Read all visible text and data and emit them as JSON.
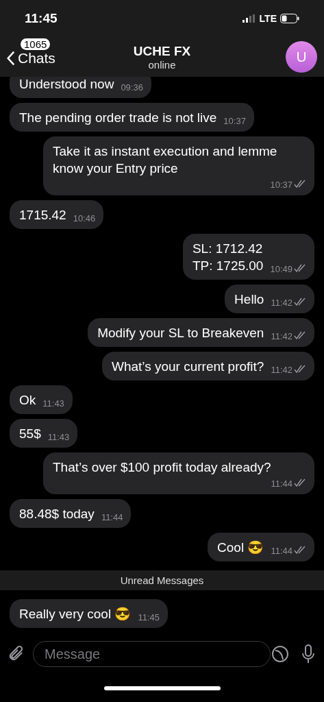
{
  "status_bar": {
    "time": "11:45",
    "network": "LTE"
  },
  "header": {
    "back_label": "Chats",
    "unread_count": "1065",
    "title": "UCHE FX",
    "subtitle": "online",
    "avatar_letter": "U"
  },
  "messages": [
    {
      "kind": "in",
      "text": "Understood now",
      "time": "09:36"
    },
    {
      "kind": "in",
      "text": "The pending order trade is not live",
      "time": "10:37"
    },
    {
      "kind": "out",
      "text": "Take it as instant execution and lemme know your Entry price",
      "time": "10:37",
      "read": true
    },
    {
      "kind": "in",
      "text": "1715.42",
      "time": "10:46"
    },
    {
      "kind": "out",
      "text": "SL: 1712.42\nTP: 1725.00",
      "time": "10:49",
      "read": true
    },
    {
      "kind": "out",
      "text": "Hello",
      "time": "11:42",
      "read": true
    },
    {
      "kind": "out",
      "text": "Modify your SL to Breakeven",
      "time": "11:42",
      "read": true
    },
    {
      "kind": "out",
      "text": "What’s your current profit?",
      "time": "11:42",
      "read": true
    },
    {
      "kind": "in",
      "text": "Ok",
      "time": "11:43"
    },
    {
      "kind": "in",
      "text": "55$",
      "time": "11:43"
    },
    {
      "kind": "out",
      "text": "That’s over $100 profit today already?",
      "time": "11:44",
      "read": true
    },
    {
      "kind": "in",
      "text": "88.48$ today",
      "time": "11:44"
    },
    {
      "kind": "out",
      "text": "Cool 😎",
      "time": "11:44",
      "read": true
    },
    {
      "kind": "divider",
      "text": "Unread Messages"
    },
    {
      "kind": "in",
      "text": "Really very cool 😎",
      "time": "11:45"
    }
  ],
  "composer": {
    "placeholder": "Message"
  }
}
